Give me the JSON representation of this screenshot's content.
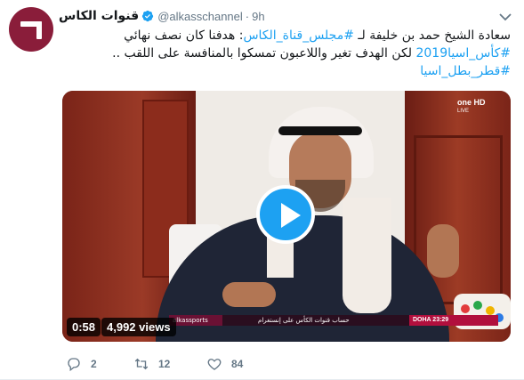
{
  "tweet": {
    "display_name": "قنوات الكاس",
    "handle": "@alkasschannel",
    "separator": "·",
    "time": "9h",
    "text_lines": [
      {
        "prefix": "سعادة الشيخ حمد بن خليفة لـ ",
        "tag": "#مجلس_قناة_الكاس",
        "suffix": ": هدفنا كان نصف نهائي"
      },
      {
        "prefix": "",
        "tag": "#كأس_اسيا2019",
        "suffix": " لكن الهدف تغير واللاعبون تمسكوا بالمنافسة على اللقب  .."
      },
      {
        "prefix": "",
        "tag": "#قطر_بطل_اسيا",
        "suffix": ""
      }
    ],
    "icons": {
      "avatar": "alkass-logo",
      "verified": "verified-badge-icon",
      "caret": "chevron-down-icon",
      "play": "play-icon",
      "reply": "reply-icon",
      "retweet": "retweet-icon",
      "like": "heart-icon"
    },
    "colors": {
      "link": "#1da1f2",
      "muted": "#657786",
      "avatar_bg": "#8a1d3a"
    }
  },
  "media": {
    "duration": "0:58",
    "views": "4,992 views",
    "broadcast_logo": "one HD",
    "broadcast_sub": "LIVE",
    "ticker_brand": "alkassports",
    "ticker_text": "حساب قنوات الكأس على إنستغرام",
    "ticker_clock": "DOHA  23:29"
  },
  "actions": {
    "reply_count": "2",
    "retweet_count": "12",
    "like_count": "84"
  }
}
